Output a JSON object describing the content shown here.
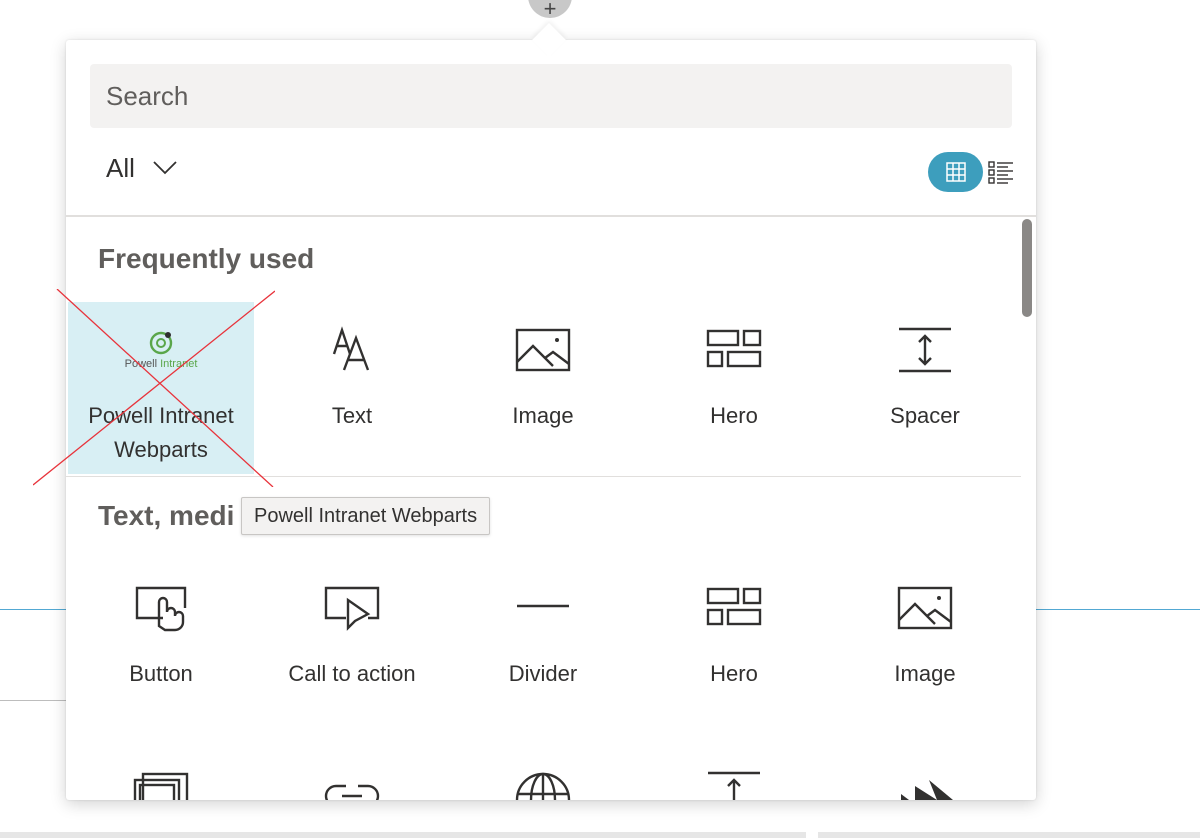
{
  "search": {
    "placeholder": "Search"
  },
  "filter": {
    "label": "All"
  },
  "sections": {
    "frequent": {
      "title": "Frequently used",
      "items": [
        {
          "label_line1": "Powell Intranet",
          "label_line2": "Webparts",
          "icon": "powell-intranet-logo",
          "selected": true
        },
        {
          "label": "Text",
          "icon": "text-icon"
        },
        {
          "label": "Image",
          "icon": "image-icon"
        },
        {
          "label": "Hero",
          "icon": "hero-icon"
        },
        {
          "label": "Spacer",
          "icon": "spacer-icon"
        }
      ]
    },
    "text_media": {
      "title": "Text, medi",
      "items": [
        {
          "label": "Button",
          "icon": "button-icon"
        },
        {
          "label": "Call to action",
          "icon": "call-to-action-icon"
        },
        {
          "label": "Divider",
          "icon": "divider-icon"
        },
        {
          "label": "Hero",
          "icon": "hero-icon"
        },
        {
          "label": "Image",
          "icon": "image-icon"
        }
      ],
      "partial_icons": [
        "image-gallery-icon",
        "link-icon",
        "globe-icon",
        "spacer-icon",
        "stream-icon"
      ]
    }
  },
  "logo": {
    "text_part1": "Powell ",
    "text_part2": "Intranet",
    "accent_color": "#5aa64a"
  },
  "tooltip": {
    "text": "Powell Intranet Webparts"
  },
  "colors": {
    "accent": "#3d9ebd",
    "selected_tile": "#d8eff4",
    "search_bg": "#f3f2f1",
    "cross": "#e8333b"
  }
}
